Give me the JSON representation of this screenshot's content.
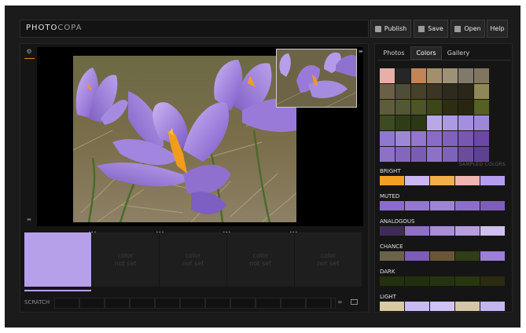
{
  "brand": {
    "part1": "PHOTO",
    "part2": "COPA"
  },
  "toolbar": {
    "publish": "Publish",
    "save": "Save",
    "open": "Open",
    "help": "Help"
  },
  "tabs": [
    {
      "label": "Photos",
      "active": false
    },
    {
      "label": "Colors",
      "active": true
    },
    {
      "label": "Gallery",
      "active": false
    }
  ],
  "color_slots": [
    {
      "line1": "",
      "line2": "",
      "color": "#b7a0ea",
      "set": true
    },
    {
      "line1": "color",
      "line2": "not set",
      "set": false
    },
    {
      "line1": "color",
      "line2": "not set",
      "set": false
    },
    {
      "line1": "color",
      "line2": "not set",
      "set": false
    },
    {
      "line1": "color",
      "line2": "not set",
      "set": false
    }
  ],
  "scratch": {
    "label": "SCRATCH"
  },
  "swatch_grid": [
    [
      "#e8aea8",
      "#262626",
      "#c38458",
      "#a48f6b",
      "#9d9276",
      "#7f7a6c",
      "#7f7560"
    ],
    [
      "#6a6046",
      "#4f4c38",
      "#47402b",
      "#3c3424",
      "#2f2a1e",
      "#2a2618",
      "#8f8757"
    ],
    [
      "#5e5d3b",
      "#525833",
      "#4d5427",
      "#3d4619",
      "#2e2c13",
      "#282611",
      "#566025"
    ],
    [
      "#3d4b21",
      "#2e3d16",
      "#2b3715",
      "#b8a9e6",
      "#ad9ae2",
      "#a48ede",
      "#9f87d8"
    ],
    [
      "#8f78d0",
      "#9d88d6",
      "#9276cf",
      "#8a6cc6",
      "#8062bc",
      "#7856b2",
      "#6b48a5"
    ],
    [
      "#8e70c6",
      "#8466bd",
      "#7b5cb5",
      "#8c72c7",
      "#7e63b9",
      "#6a4c9b",
      "#5e4190"
    ]
  ],
  "sampled_label": "SAMPLED COLORS",
  "schemes": [
    {
      "name": "BRIGHT",
      "colors": [
        "#f2a024",
        "#c9b6f3",
        "#f3b04a",
        "#f0b5b0",
        "#b69cf1"
      ]
    },
    {
      "name": "MUTED",
      "colors": [
        "#8b6ccc",
        "#9478cf",
        "#9d85d4",
        "#8d6fca",
        "#7d5fbb"
      ]
    },
    {
      "name": "ANALOGOUS",
      "colors": [
        "#3f2b57",
        "#8e70c6",
        "#a98ed8",
        "#b69ee0",
        "#cfc0ef"
      ]
    },
    {
      "name": "CHANCE",
      "colors": [
        "#6b6349",
        "#7c5cb5",
        "#6a5636",
        "#303d18",
        "#9c7fd6"
      ]
    },
    {
      "name": "DARK",
      "colors": [
        "#22300e",
        "#222f0d",
        "#253410",
        "#27360f",
        "#2c2a0f"
      ]
    },
    {
      "name": "LIGHT",
      "colors": [
        "#d8c8a4",
        "#c9bbf1",
        "#d0c2f1",
        "#d3c7a6",
        "#c5b5ef"
      ]
    }
  ]
}
